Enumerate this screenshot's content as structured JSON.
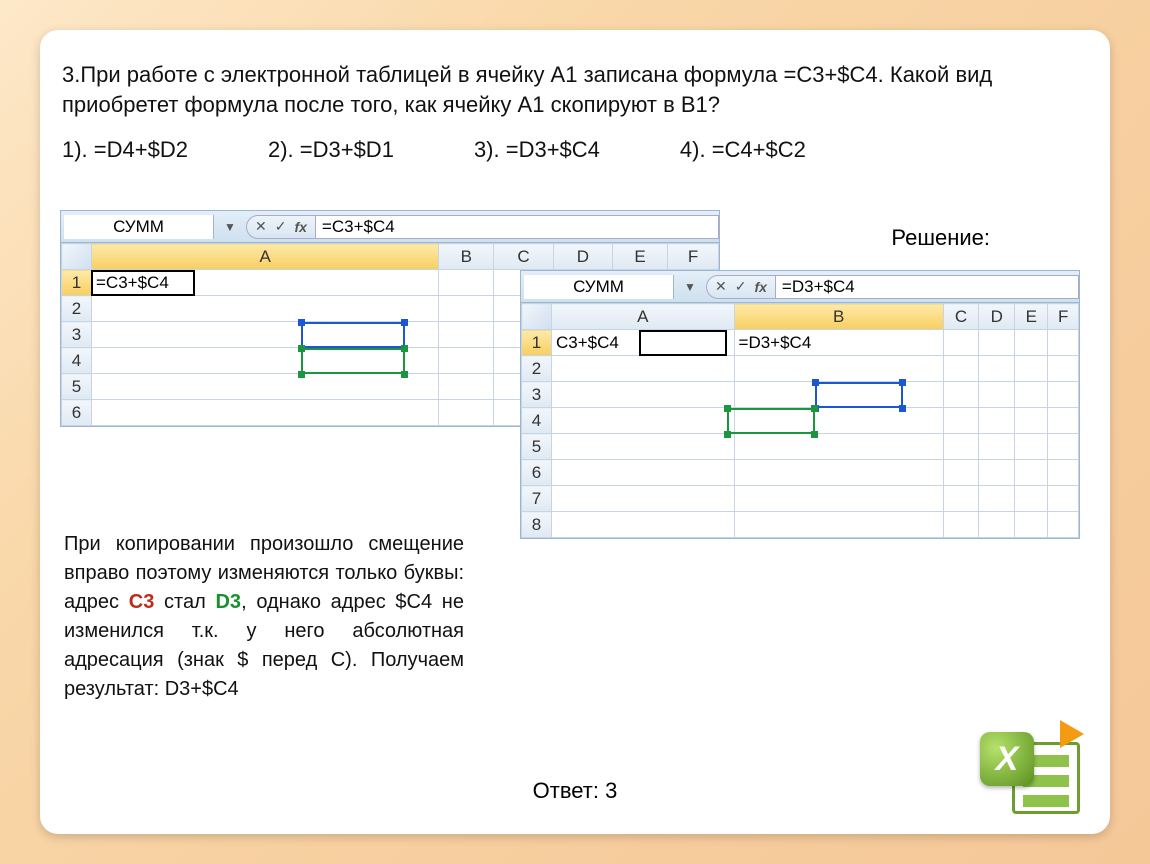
{
  "question": "3.При работе с электронной таблицей в ячейку А1 записана формула =С3+$C4. Какой вид приобретет формула после того, как  ячейку А1 скопируют в В1?",
  "options": {
    "o1": "1). =D4+$D2",
    "o2": "2). =D3+$D1",
    "o3": "3). =D3+$C4",
    "o4": "4). =C4+$C2"
  },
  "solution_label": "Решение:",
  "excel1": {
    "namebox": "СУММ",
    "formula": "=C3+$C4",
    "cols": [
      "A",
      "B",
      "C",
      "D",
      "E",
      "F"
    ],
    "rows": [
      "1",
      "2",
      "3",
      "4",
      "5",
      "6"
    ],
    "a1": "=C3+$C4"
  },
  "excel2": {
    "namebox": "СУММ",
    "formula": "=D3+$C4",
    "cols": [
      "A",
      "B",
      "C",
      "D",
      "E",
      "F"
    ],
    "rows": [
      "1",
      "2",
      "3",
      "4",
      "5",
      "6",
      "7",
      "8"
    ],
    "a1": "C3+$C4",
    "b1": "=D3+$C4"
  },
  "explain_parts": {
    "p1": "При копировании произошло смещение вправо поэтому изменяются только буквы: адрес ",
    "c3": "C3",
    "p2": " стал ",
    "d3": "D3",
    "p3": ", однако адрес $C4 не изменился т.к. у него абсолютная адресация (знак $ перед С). Получаем результат: D3+$C4"
  },
  "answer": "Ответ: 3",
  "fx_symbols": {
    "cancel": "✕",
    "ok": "✓",
    "fx": "fx"
  }
}
